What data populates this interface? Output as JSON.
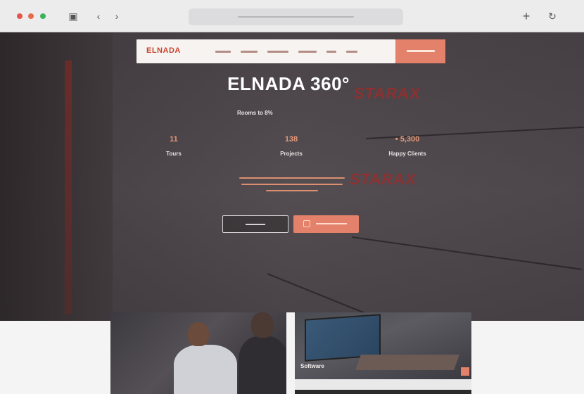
{
  "browser": {
    "icons": {
      "tabs": "tabs-icon",
      "back": "back-arrow-icon",
      "forward": "forward-arrow-icon",
      "new_tab": "plus-icon",
      "reload": "reload-icon"
    },
    "traffic_lights": [
      "#e5534b",
      "#e86a50",
      "#3cb35a"
    ]
  },
  "site": {
    "logo": "ELNADA",
    "nav_cta_color": "#e3816a",
    "hero": {
      "title": "ELNADA 360°",
      "subtitle": "Rooms to 8%",
      "watermark": "STARAX",
      "stats": [
        {
          "value": "11",
          "label": "Tours"
        },
        {
          "value": "138",
          "label": "Projects"
        },
        {
          "value": "• 5,300",
          "label": "Happy Clients"
        }
      ]
    },
    "cards": [
      {
        "caption": "Software"
      }
    ]
  }
}
